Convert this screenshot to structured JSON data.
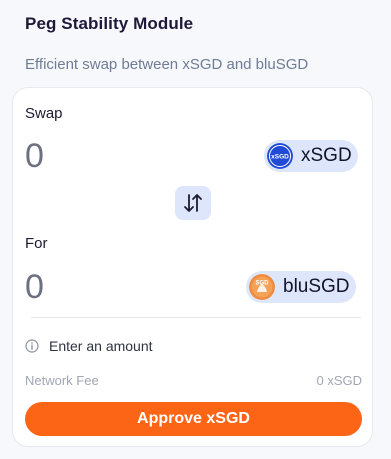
{
  "header": {
    "title": "Peg Stability Module",
    "subtitle": "Efficient swap between xSGD and bluSGD"
  },
  "swap": {
    "from_label": "Swap",
    "from_amount_placeholder": "0",
    "from_token": {
      "name": "xSGD",
      "logo_text": "xSGD",
      "icon": "xsgd-token-icon",
      "color": "#1f4bd6"
    },
    "to_label": "For",
    "to_amount_placeholder": "0",
    "to_token": {
      "name": "bluSGD",
      "logo_text": "SGD",
      "icon": "blusgd-token-icon",
      "color": "#f08a3c"
    },
    "switch_icon": "swap-direction-icon"
  },
  "status": {
    "icon": "info-icon",
    "message": "Enter an amount"
  },
  "fee": {
    "label": "Network Fee",
    "value": "0 xSGD"
  },
  "action": {
    "label": "Approve xSGD",
    "color": "#fc6515"
  },
  "colors": {
    "background": "#f6f8fb",
    "card": "#ffffff",
    "pill": "#dde6fb",
    "accent": "#fc6515"
  }
}
